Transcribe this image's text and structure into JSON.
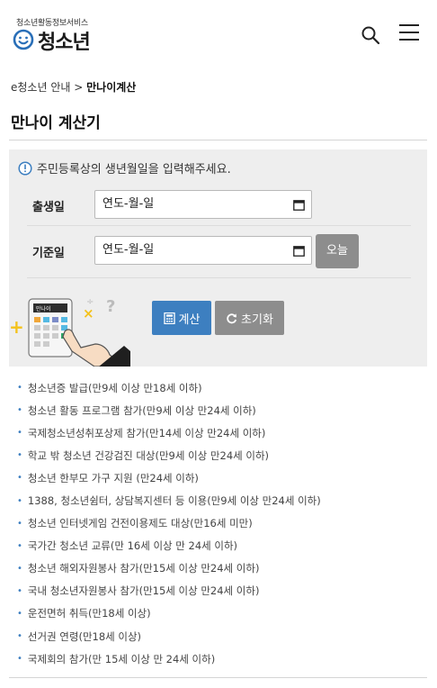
{
  "header": {
    "logo_small": "청소년활동정보서비스",
    "logo_main": "청소년",
    "logo_mark_icon": "smile-face-icon",
    "search_icon": "search-icon",
    "menu_icon": "hamburger-menu-icon"
  },
  "breadcrumb": {
    "parent": "e청소년 안내",
    "separator": ">",
    "current": "만나이계산"
  },
  "page": {
    "title": "만나이 계산기"
  },
  "calculator": {
    "notice": "주민등록상의 생년월일을 입력해주세요.",
    "notice_icon": "info-circle-icon",
    "birth_label": "출생일",
    "birth_value": "연도-월-일",
    "base_label": "기준일",
    "base_value": "연도-월-일",
    "today_button": "오늘",
    "calc_button": "계산",
    "reset_button": "초기화",
    "calendar_icon": "calendar-icon",
    "illustration": "calculator-hand-illustration",
    "illust_screen_text": "만나이"
  },
  "age_rules": [
    "청소년증 발급(만9세 이상 만18세 이하)",
    "청소년 활동 프로그램 참가(만9세 이상 만24세 이하)",
    "국제청소년성취포상제 참가(만14세 이상 만24세 이하)",
    "학교 밖 청소년 건강검진 대상(만9세 이상 만24세 이하)",
    "청소년 한부모 가구 지원 (만24세 이하)",
    "1388, 청소년쉼터, 상담복지센터 등 이용(만9세 이상 만24세 이하)",
    "청소년 인터넷게임 건전이용제도 대상(만16세 미만)",
    "국가간 청소년 교류(만 16세 이상 만 24세 이하)",
    "청소년 해외자원봉사 참가(만15세 이상 만24세 이하)",
    "국내 청소년자원봉사 참가(만15세 이상 만24세 이하)",
    "운전면허 취득(만18세 이상)",
    "선거권 연령(만18세 이상)",
    "국제회의 참가(만 15세 이상 만 24세 이하)"
  ],
  "colors": {
    "accent": "#3d7fc0",
    "gray_button": "#8d8d8d",
    "panel_bg": "#eeeeee"
  }
}
